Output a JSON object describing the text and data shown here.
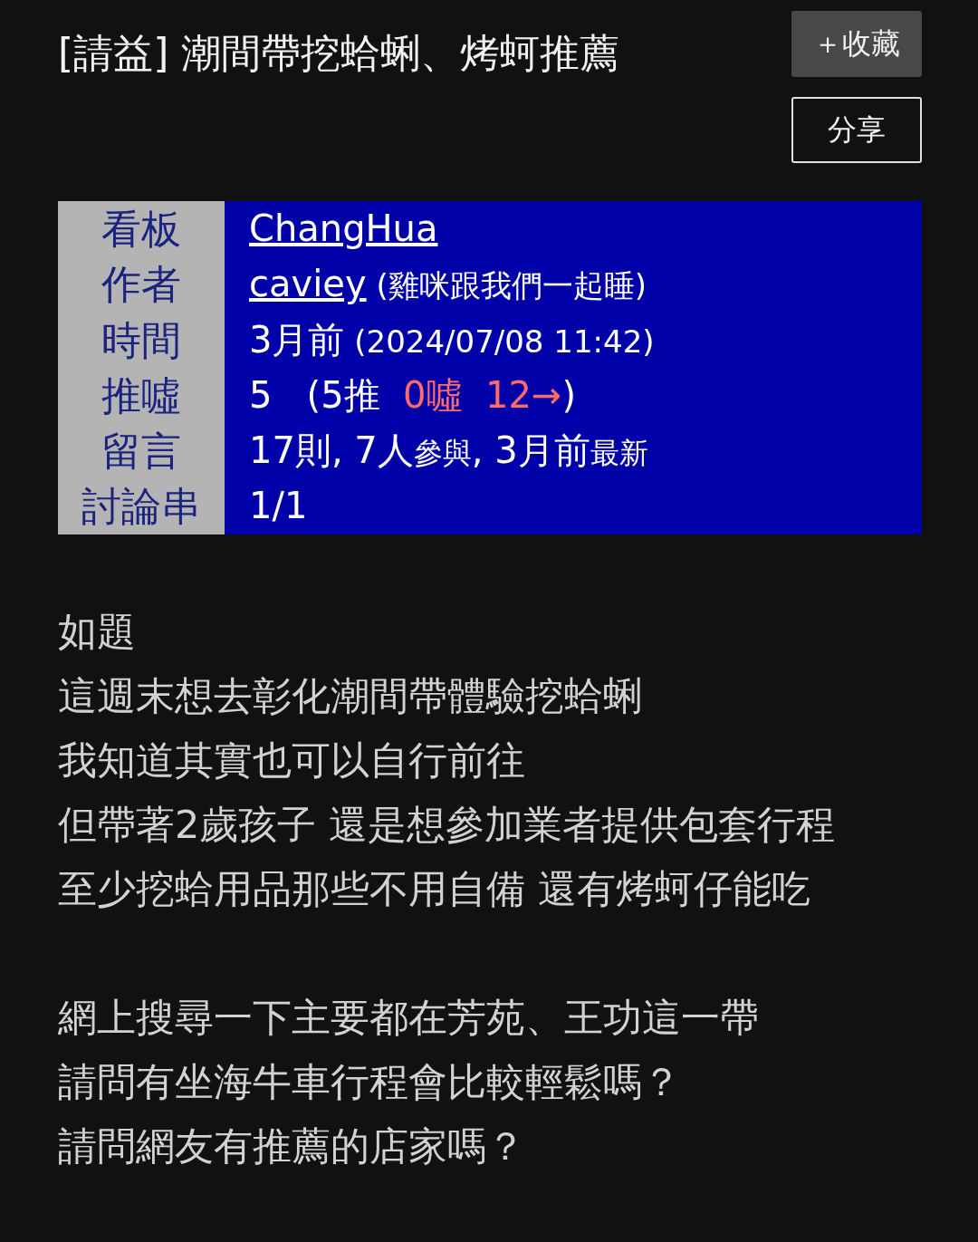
{
  "title": "[請益] 潮間帶挖蛤蜊、烤蚵推薦",
  "buttons": [
    {
      "label": "＋收藏",
      "kind": "filled"
    },
    {
      "label": "分享",
      "kind": "outline"
    }
  ],
  "meta": [
    {
      "label": "看板",
      "parts": [
        {
          "text": "ChangHua",
          "kind": "link"
        }
      ]
    },
    {
      "label": "作者",
      "parts": [
        {
          "text": "caviey",
          "kind": "link"
        },
        {
          "text": " (雞咪跟我們一起睡)",
          "kind": "note"
        }
      ]
    },
    {
      "label": "時間",
      "parts": [
        {
          "text": "3月前",
          "kind": "text"
        },
        {
          "text": " (2024/07/08 11:42)",
          "kind": "note"
        }
      ]
    },
    {
      "label": "推噓",
      "parts": [
        {
          "text": "5   (5推 ",
          "kind": "text"
        },
        {
          "text": " 0噓  12→",
          "kind": "boo"
        },
        {
          "text": ")",
          "kind": "text"
        }
      ]
    },
    {
      "label": "留言",
      "parts": [
        {
          "text": "17則, 7人",
          "kind": "text"
        },
        {
          "text": "參與",
          "kind": "suffix"
        },
        {
          "text": ", 3月前",
          "kind": "text"
        },
        {
          "text": "最新",
          "kind": "suffix"
        }
      ]
    },
    {
      "label": "討論串",
      "parts": [
        {
          "text": "1/1",
          "kind": "text"
        }
      ]
    }
  ],
  "body": [
    [
      "如題",
      "這週末想去彰化潮間帶體驗挖蛤蜊",
      "我知道其實也可以自行前往",
      "但帶著2歲孩子 還是想參加業者提供包套行程",
      "至少挖蛤用品那些不用自備 還有烤蚵仔能吃"
    ],
    [
      "網上搜尋一下主要都在芳苑、王功這一帶",
      "請問有坐海牛車行程會比較輕鬆嗎？",
      "請問網友有推薦的店家嗎？"
    ]
  ]
}
